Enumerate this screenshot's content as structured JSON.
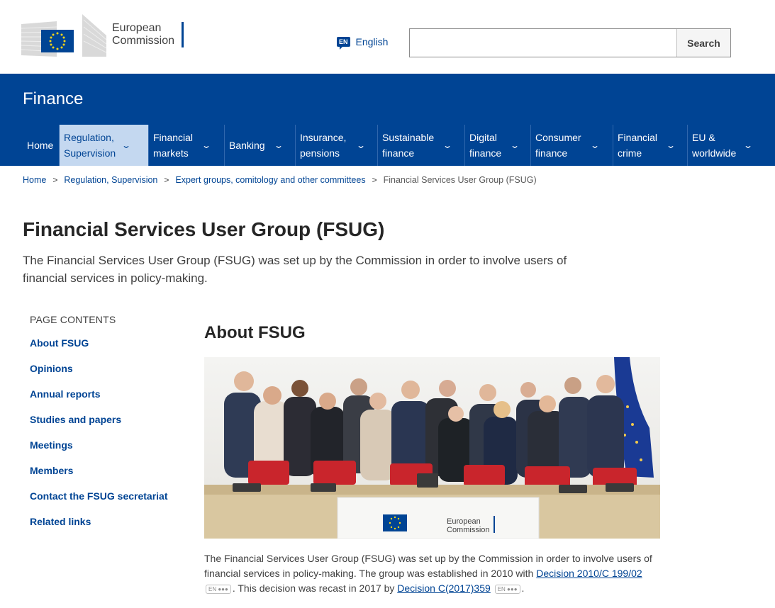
{
  "header": {
    "logo_line1": "European",
    "logo_line2": "Commission",
    "language_code": "EN",
    "language_label": "English",
    "search_placeholder": "",
    "search_button": "Search"
  },
  "site": {
    "title": "Finance"
  },
  "nav": {
    "items": [
      {
        "l1": "Home",
        "l2": ""
      },
      {
        "l1": "Regulation,",
        "l2": "Supervision"
      },
      {
        "l1": "Financial",
        "l2": "markets"
      },
      {
        "l1": "Banking",
        "l2": ""
      },
      {
        "l1": "Insurance,",
        "l2": "pensions"
      },
      {
        "l1": "Sustainable",
        "l2": "finance"
      },
      {
        "l1": "Digital",
        "l2": "finance"
      },
      {
        "l1": "Consumer",
        "l2": "finance"
      },
      {
        "l1": "Financial",
        "l2": "crime"
      },
      {
        "l1": "EU &",
        "l2": "worldwide"
      }
    ]
  },
  "breadcrumb": {
    "items": [
      "Home",
      "Regulation, Supervision",
      "Expert groups, comitology and other committees"
    ],
    "current": "Financial Services User Group (FSUG)"
  },
  "page": {
    "title": "Financial Services User Group (FSUG)",
    "intro": "The Financial Services User Group (FSUG) was set up by the Commission in order to involve users of financial services in policy-making."
  },
  "toc": {
    "heading": "PAGE CONTENTS",
    "items": [
      "About FSUG",
      "Opinions",
      "Annual reports",
      "Studies and papers",
      "Meetings",
      "Members",
      "Contact the FSUG secretariat",
      "Related links"
    ]
  },
  "main": {
    "section_title": "About FSUG",
    "photo_sign_line1": "European",
    "photo_sign_line2": "Commission",
    "para_start": "The Financial Services User Group (FSUG) was set up by the Commission in order to involve users of financial services in policy-making. The group was established in 2010 with ",
    "link1": "Decision 2010/C 199/02",
    "en_mark1": "EN ●●●",
    "para_mid": ". This decision was recast in 2017 by ",
    "link2": "Decision C(2017)359",
    "en_mark2": "EN ●●●",
    "para_end": "."
  }
}
